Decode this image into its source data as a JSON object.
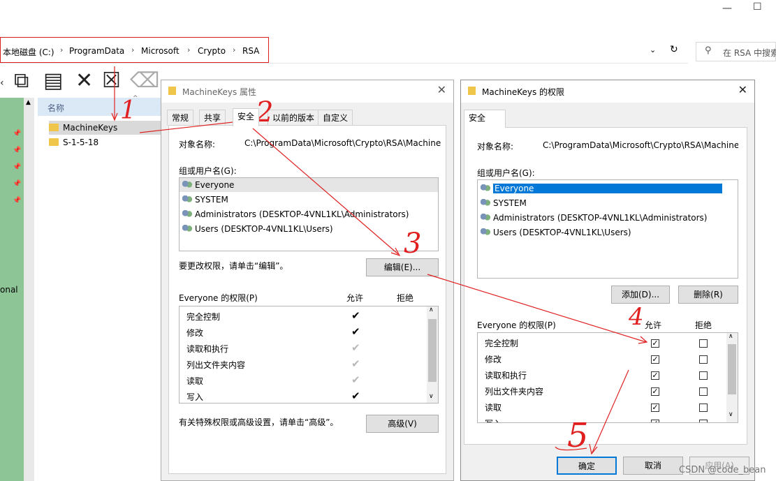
{
  "explorer": {
    "window_buttons": [
      "—",
      "☐"
    ],
    "breadcrumb": [
      "本地磁盘 (C:)",
      "ProgramData",
      "Microsoft",
      "Crypto",
      "RSA"
    ],
    "search_placeholder": "在 RSA 中搜索",
    "column_name": "名称",
    "files": [
      "MachineKeys",
      "S-1-5-18"
    ],
    "nav_fragment": "onal"
  },
  "props_dialog": {
    "title": "MachineKeys 属性",
    "tabs": [
      "常规",
      "共享",
      "安全",
      "以前的版本",
      "自定义"
    ],
    "active_tab": "安全",
    "object_name_label": "对象名称:",
    "object_name_value": "C:\\ProgramData\\Microsoft\\Crypto\\RSA\\Machine",
    "group_label": "组或用户名(G):",
    "users": [
      "Everyone",
      "SYSTEM",
      "Administrators (DESKTOP-4VNL1KL\\Administrators)",
      "Users (DESKTOP-4VNL1KL\\Users)"
    ],
    "change_hint": "要更改权限，请单击“编辑”。",
    "edit_button": "编辑(E)...",
    "perm_label": "Everyone 的权限(P)",
    "allow_header": "允许",
    "deny_header": "拒绝",
    "permissions": [
      {
        "name": "完全控制",
        "allow": "✔",
        "allow_grey": false
      },
      {
        "name": "修改",
        "allow": "✔",
        "allow_grey": false
      },
      {
        "name": "读取和执行",
        "allow": "✔",
        "allow_grey": true
      },
      {
        "name": "列出文件夹内容",
        "allow": "✔",
        "allow_grey": true
      },
      {
        "name": "读取",
        "allow": "✔",
        "allow_grey": true
      },
      {
        "name": "写入",
        "allow": "✔",
        "allow_grey": false
      }
    ],
    "advanced_hint": "有关特殊权限或高级设置，请单击“高级”。",
    "advanced_button": "高级(V)"
  },
  "perm_dialog": {
    "title": "MachineKeys 的权限",
    "tab": "安全",
    "object_name_label": "对象名称:",
    "object_name_value": "C:\\ProgramData\\Microsoft\\Crypto\\RSA\\Machine",
    "group_label": "组或用户名(G):",
    "users": [
      "Everyone",
      "SYSTEM",
      "Administrators (DESKTOP-4VNL1KL\\Administrators)",
      "Users (DESKTOP-4VNL1KL\\Users)"
    ],
    "selected_user": "Everyone",
    "add_button": "添加(D)...",
    "remove_button": "删除(R)",
    "perm_label": "Everyone 的权限(P)",
    "allow_header": "允许",
    "deny_header": "拒绝",
    "permissions": [
      {
        "name": "完全控制",
        "allow": true,
        "deny": false
      },
      {
        "name": "修改",
        "allow": true,
        "deny": false
      },
      {
        "name": "读取和执行",
        "allow": true,
        "deny": false
      },
      {
        "name": "列出文件夹内容",
        "allow": true,
        "deny": false
      },
      {
        "name": "读取",
        "allow": true,
        "deny": false
      },
      {
        "name": "写入",
        "allow": true,
        "deny": false
      }
    ],
    "ok_button": "确定",
    "cancel_button": "取消",
    "apply_button": "应用(A)"
  },
  "annotations": [
    "1",
    "2",
    "3",
    "4",
    "5"
  ],
  "watermark": "CSDN @code_bean",
  "colors": {
    "annotation": "#e02020",
    "selection": "#0078d7",
    "nav_green": "#8dc596",
    "header_blue": "#dbe9f7"
  }
}
